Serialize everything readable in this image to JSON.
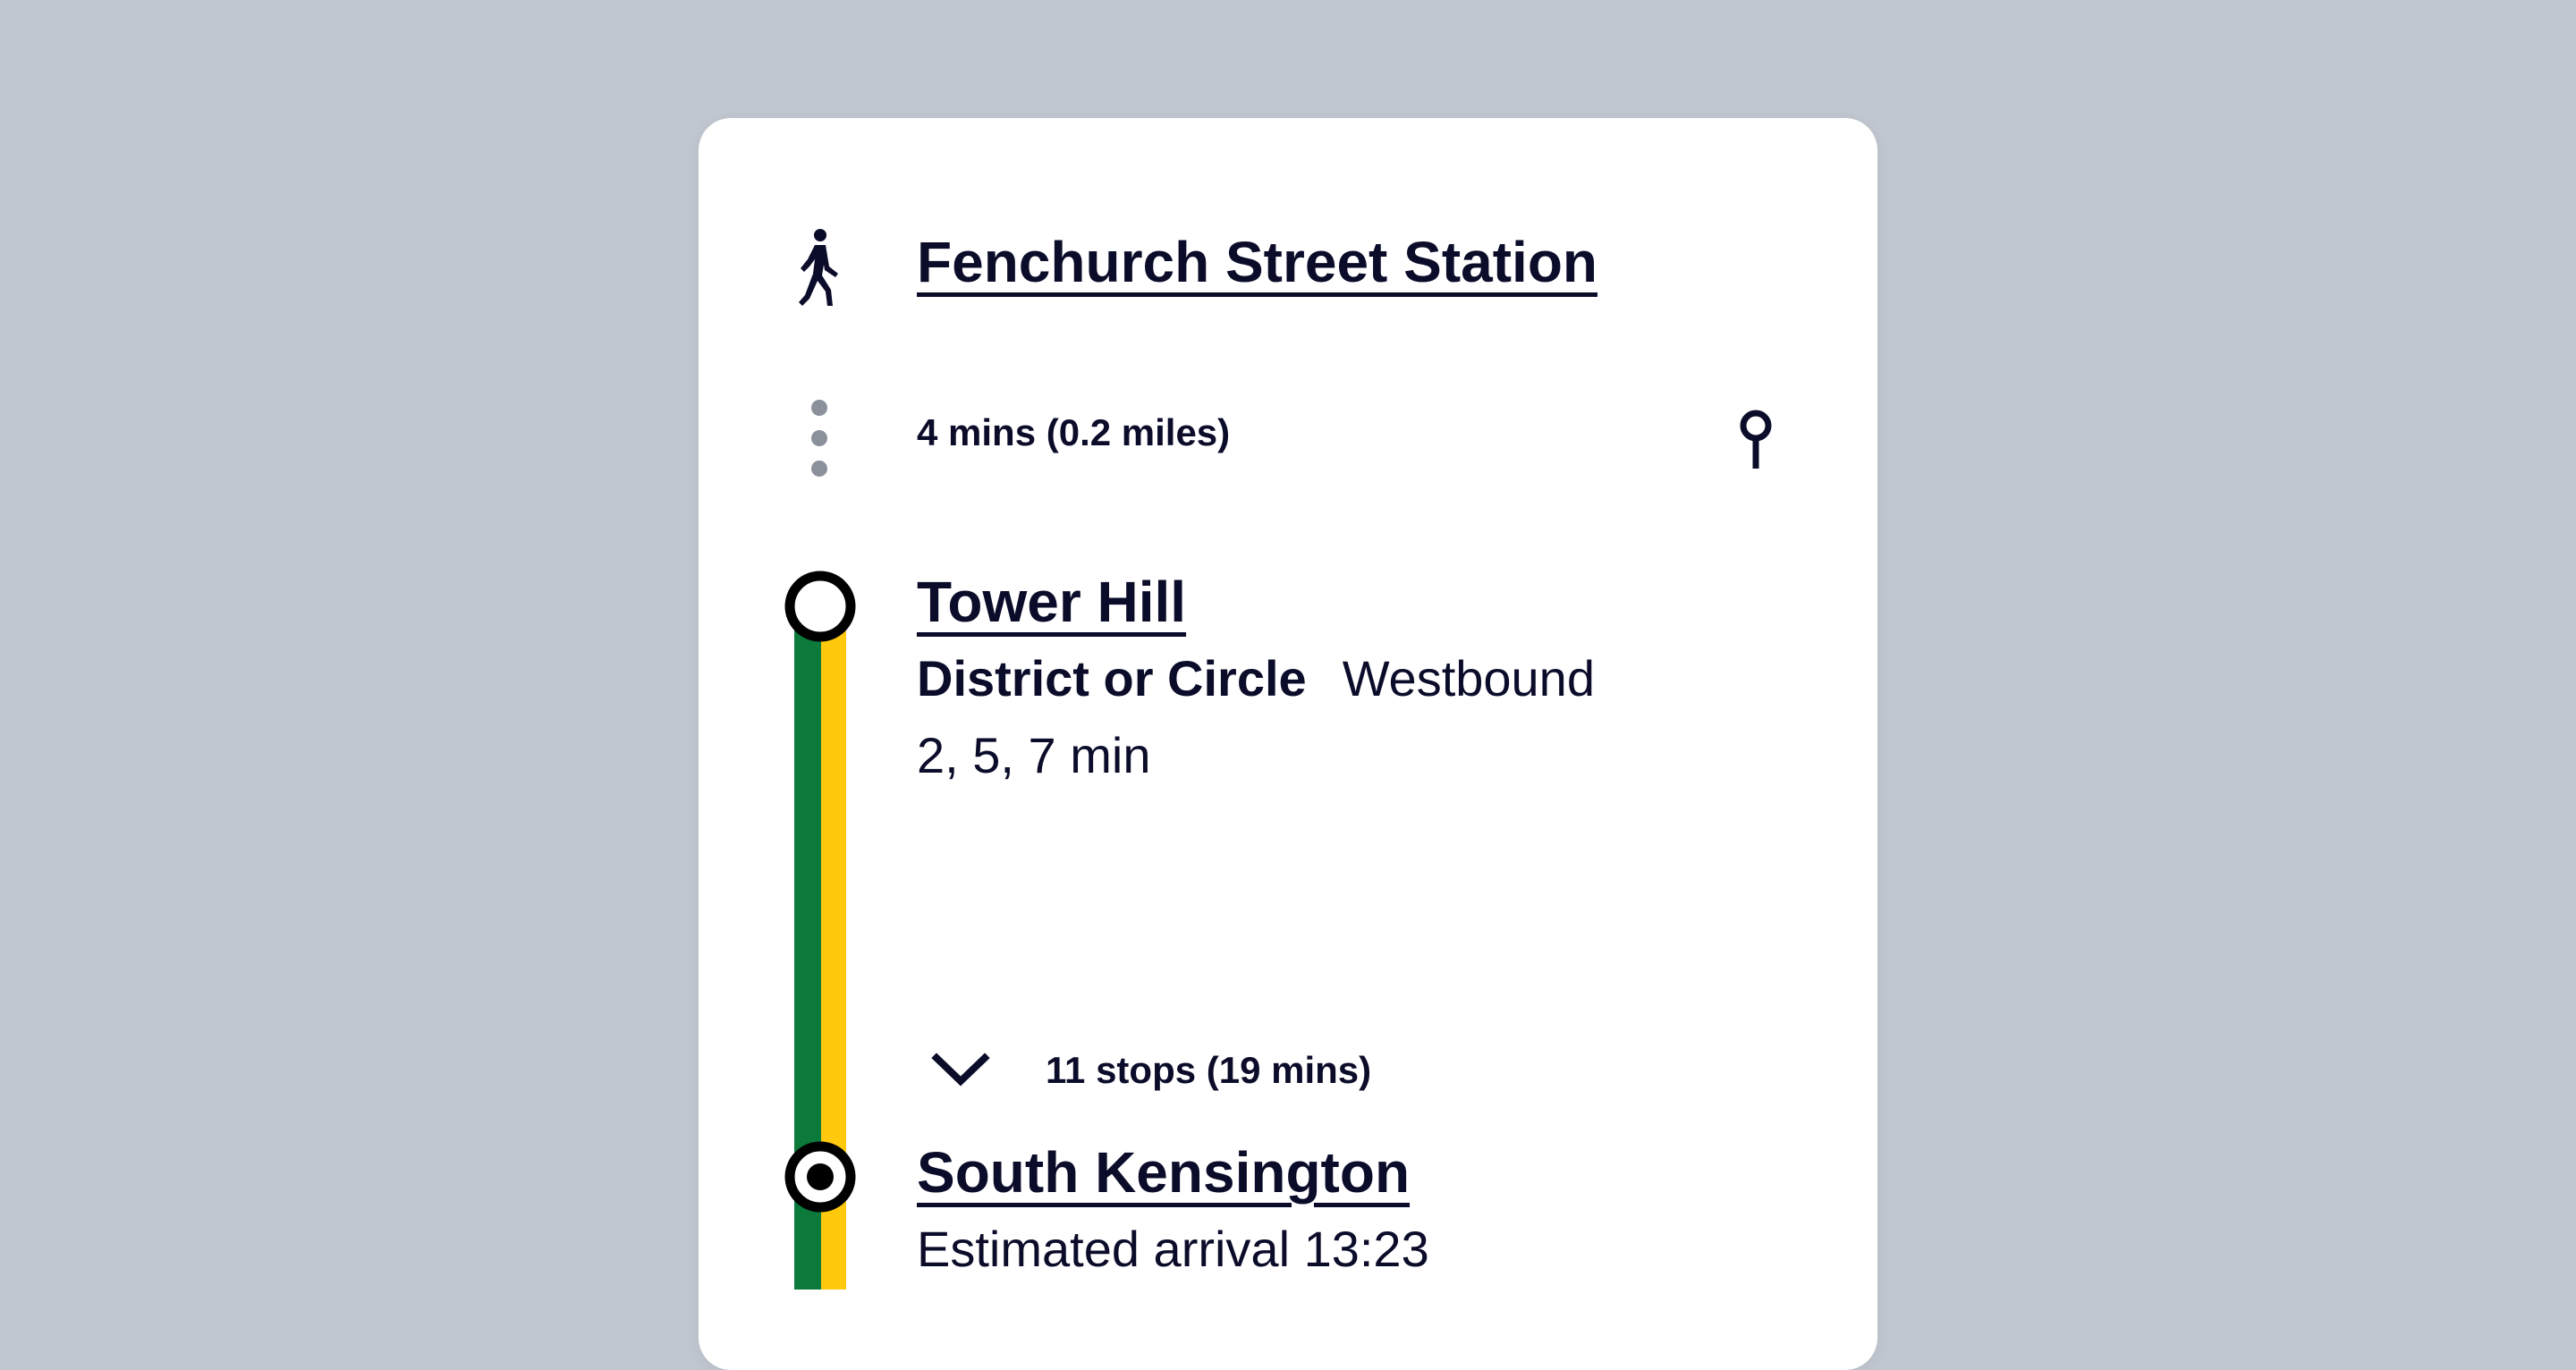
{
  "journey": {
    "origin": {
      "name": "Fenchurch Street Station",
      "mode_icon": "walk-icon"
    },
    "walk": {
      "duration": "4 mins (0.2 miles)",
      "map_icon": "map-pin-icon"
    },
    "leg": {
      "board_stop": "Tower Hill",
      "line_name": "District or Circle",
      "direction": "Westbound",
      "departures": "2, 5, 7 min",
      "stops_summary": "11 stops (19 mins)",
      "alight_stop": "South Kensington",
      "arrival": "Estimated arrival 13:23",
      "line_colors": {
        "district": "#0b7a3b",
        "circle": "#ffc90d"
      }
    }
  },
  "colors": {
    "background": "#c1c7d0",
    "card": "#ffffff",
    "text": "#0b0c2a",
    "dots": "#8b919b"
  }
}
